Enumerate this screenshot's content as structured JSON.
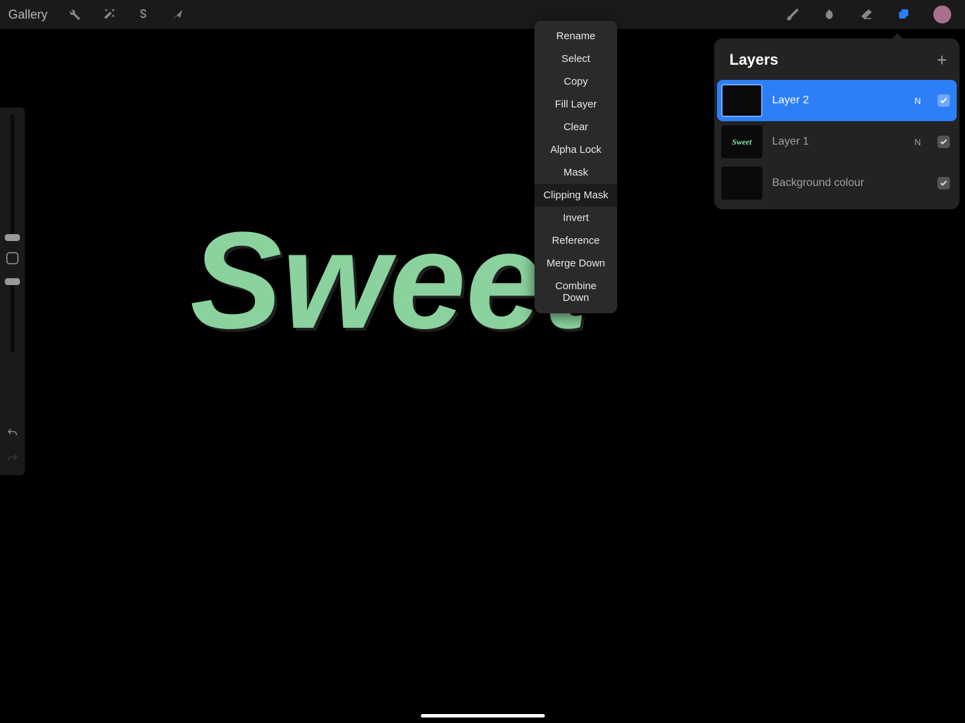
{
  "topbar": {
    "gallery_label": "Gallery"
  },
  "context_menu": {
    "items": [
      {
        "label": "Rename",
        "highlighted": false
      },
      {
        "label": "Select",
        "highlighted": false
      },
      {
        "label": "Copy",
        "highlighted": false
      },
      {
        "label": "Fill Layer",
        "highlighted": false
      },
      {
        "label": "Clear",
        "highlighted": false
      },
      {
        "label": "Alpha Lock",
        "highlighted": false
      },
      {
        "label": "Mask",
        "highlighted": false
      },
      {
        "label": "Clipping Mask",
        "highlighted": true
      },
      {
        "label": "Invert",
        "highlighted": false
      },
      {
        "label": "Reference",
        "highlighted": false
      },
      {
        "label": "Merge Down",
        "highlighted": false
      },
      {
        "label": "Combine Down",
        "highlighted": false
      }
    ]
  },
  "layers_panel": {
    "title": "Layers",
    "layers": [
      {
        "name": "Layer 2",
        "blend": "N",
        "visible": true,
        "selected": true,
        "thumb": "empty"
      },
      {
        "name": "Layer 1",
        "blend": "N",
        "visible": true,
        "selected": false,
        "thumb": "sweet"
      },
      {
        "name": "Background colour",
        "blend": "",
        "visible": true,
        "selected": false,
        "thumb": "black"
      }
    ]
  },
  "canvas": {
    "artwork_text": "Sweet",
    "artwork_color": "#96e3ab"
  },
  "colors": {
    "accent": "#2c7ff7",
    "swatch": "#a96f91"
  }
}
